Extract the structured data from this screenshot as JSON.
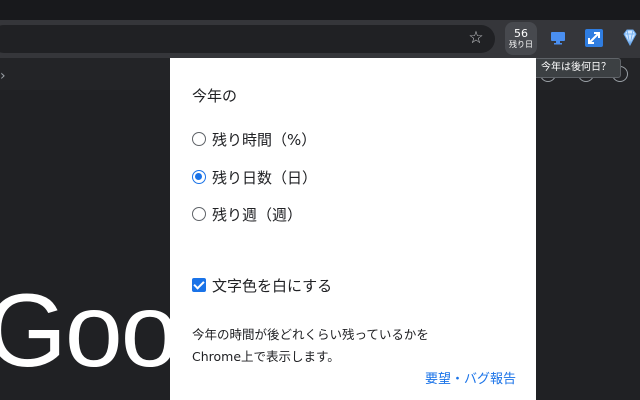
{
  "browser": {
    "toolbar": {
      "bookmark_icon": "star-outline-icon"
    },
    "extensions": {
      "counter": {
        "value": "56",
        "caption": "残り日"
      },
      "monitor_icon": "monitor-icon",
      "resize_icon": "expand-arrows-icon",
      "gem_icon": "diamond-icon"
    },
    "tooltip": "今年は後何日？"
  },
  "page": {
    "logo_partial": "Goo"
  },
  "popup": {
    "heading": "今年の",
    "options": [
      {
        "label": "残り時間（%）",
        "selected": false
      },
      {
        "label": "残り日数（日）",
        "selected": true
      },
      {
        "label": "残り週（週）",
        "selected": false
      }
    ],
    "checkbox": {
      "label": "文字色を白にする",
      "checked": true
    },
    "description_line1": "今年の時間が後どれくらい残っているかを",
    "description_line2": "Chrome上で表示します。",
    "link": "要望・バグ報告"
  },
  "colors": {
    "accent": "#1a73e8",
    "toolbar": "#35363a",
    "page_bg": "#202124",
    "popup_bg": "#ffffff"
  }
}
